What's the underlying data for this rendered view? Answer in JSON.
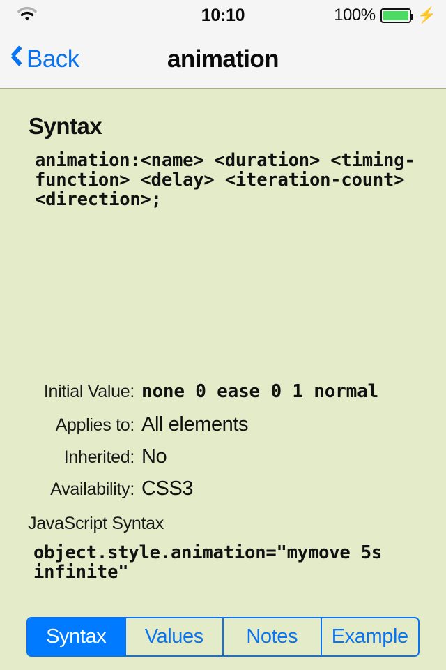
{
  "status_bar": {
    "wifi_icon": "wifi-icon",
    "time": "10:10",
    "battery_percent": "100%",
    "battery_icon": "battery-full-icon",
    "charging_icon": "lightning-bolt-icon"
  },
  "nav_bar": {
    "back_icon": "chevron-left-icon",
    "back_label": "Back",
    "title": "animation"
  },
  "content": {
    "section_heading": "Syntax",
    "syntax_code": "animation:<name> <duration> <timing-function> <delay> <iteration-count> <direction>;",
    "properties": [
      {
        "label": "Initial Value:",
        "value": "none 0 ease 0 1 normal",
        "mono": true
      },
      {
        "label": "Applies to:",
        "value": "All elements",
        "mono": false
      },
      {
        "label": "Inherited:",
        "value": "No",
        "mono": false
      },
      {
        "label": "Availability:",
        "value": "CSS3",
        "mono": false
      }
    ],
    "js_label": "JavaScript Syntax",
    "js_code": "object.style.animation=\"mymove 5s infinite\""
  },
  "segmented_control": {
    "segments": [
      {
        "label": "Syntax",
        "active": true
      },
      {
        "label": "Values",
        "active": false
      },
      {
        "label": "Notes",
        "active": false
      },
      {
        "label": "Example",
        "active": false
      }
    ]
  },
  "colors": {
    "accent_blue": "#007AFF",
    "link_blue": "#0a74f0",
    "content_bg": "#E4EBC8",
    "bar_bg": "#F5F5F5",
    "separator": "#A9AE86",
    "battery_green": "#4CD964"
  }
}
